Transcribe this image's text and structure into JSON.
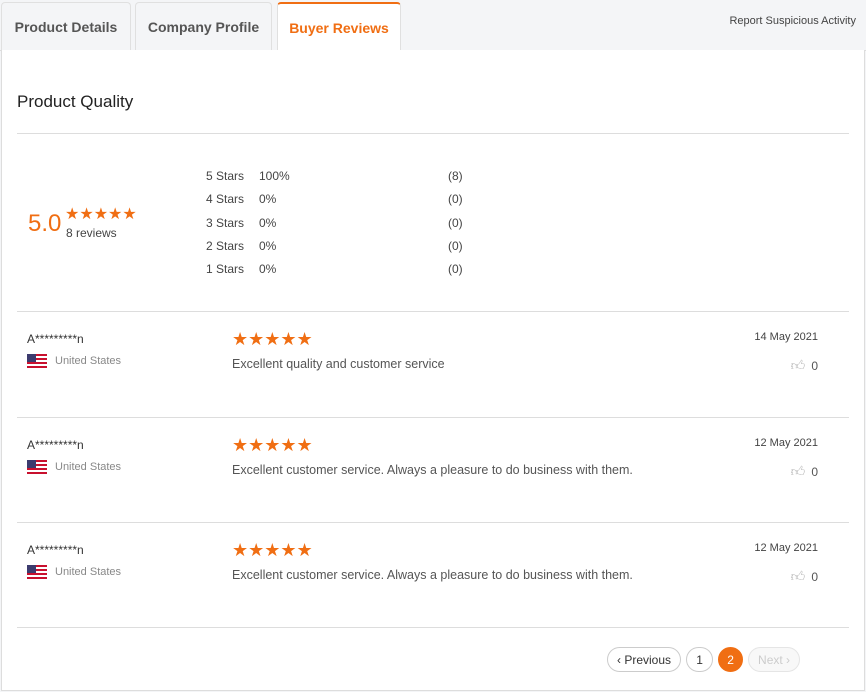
{
  "tabs": [
    {
      "label": "Product Details"
    },
    {
      "label": "Company Profile"
    },
    {
      "label": "Buyer Reviews"
    }
  ],
  "report_link": "Report Suspicious Activity",
  "section_title": "Product Quality",
  "summary": {
    "score": "5.0",
    "stars": "★★★★★",
    "review_count": "8 reviews"
  },
  "distribution": [
    {
      "label": "5 Stars",
      "percent": "100%",
      "count": "(8)"
    },
    {
      "label": "4 Stars",
      "percent": "0%",
      "count": "(0)"
    },
    {
      "label": "3 Stars",
      "percent": "0%",
      "count": "(0)"
    },
    {
      "label": "2 Stars",
      "percent": "0%",
      "count": "(0)"
    },
    {
      "label": "1 Stars",
      "percent": "0%",
      "count": "(0)"
    }
  ],
  "reviews": [
    {
      "name": "A*********n",
      "country": "United States",
      "stars": "★★★★★",
      "text": "Excellent quality and customer service",
      "date": "14 May 2021",
      "likes": "0"
    },
    {
      "name": "A*********n",
      "country": "United States",
      "stars": "★★★★★",
      "text": "Excellent customer service. Always a pleasure to do business with them.",
      "date": "12 May 2021",
      "likes": "0"
    },
    {
      "name": "A*********n",
      "country": "United States",
      "stars": "★★★★★",
      "text": "Excellent customer service. Always a pleasure to do business with them.",
      "date": "12 May 2021",
      "likes": "0"
    }
  ],
  "pagination": {
    "previous": "Previous",
    "pages": [
      "1",
      "2"
    ],
    "current": "2",
    "next": "Next"
  },
  "colors": {
    "accent": "#f06e13"
  }
}
